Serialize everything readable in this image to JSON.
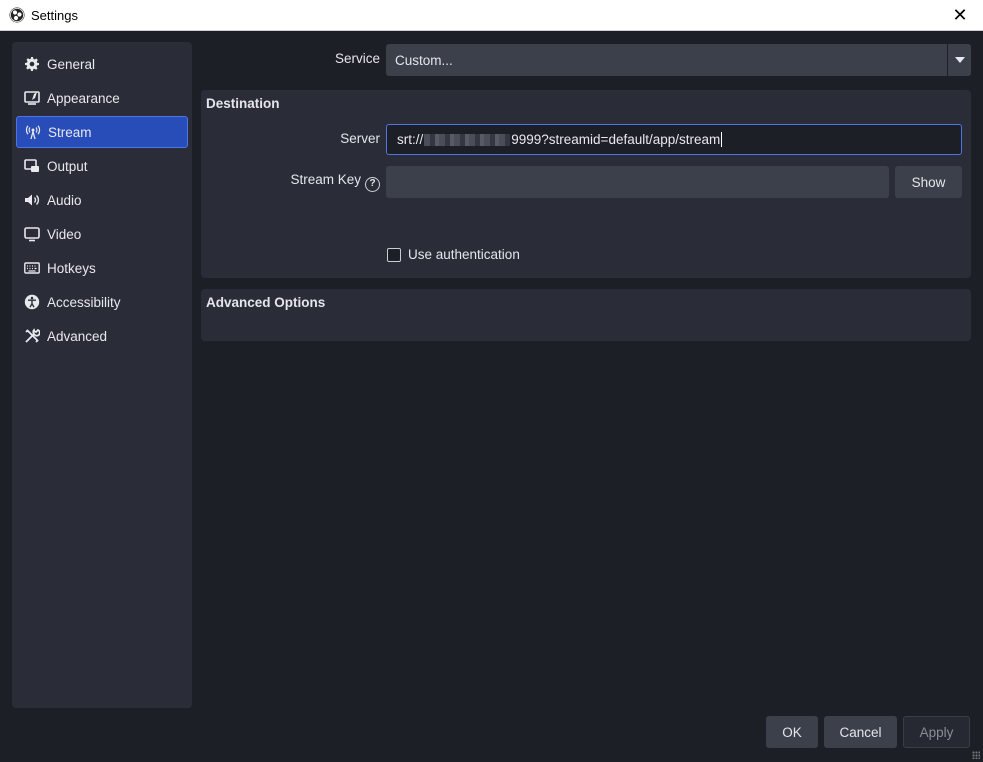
{
  "window": {
    "title": "Settings",
    "close_glyph": "✕"
  },
  "sidebar": {
    "items": [
      {
        "label": "General",
        "icon": "gear-icon"
      },
      {
        "label": "Appearance",
        "icon": "appearance-icon"
      },
      {
        "label": "Stream",
        "icon": "antenna-icon",
        "active": true
      },
      {
        "label": "Output",
        "icon": "output-icon"
      },
      {
        "label": "Audio",
        "icon": "speaker-icon"
      },
      {
        "label": "Video",
        "icon": "monitor-icon"
      },
      {
        "label": "Hotkeys",
        "icon": "keyboard-icon"
      },
      {
        "label": "Accessibility",
        "icon": "accessibility-icon"
      },
      {
        "label": "Advanced",
        "icon": "tools-icon"
      }
    ]
  },
  "service": {
    "label": "Service",
    "value": "Custom..."
  },
  "destination": {
    "title": "Destination",
    "server_label": "Server",
    "server_prefix": "srt://",
    "server_suffix": "9999?streamid=default/app/stream",
    "stream_key_label": "Stream Key",
    "stream_key_value": "",
    "show_label": "Show",
    "use_auth_label": "Use authentication",
    "use_auth_checked": false
  },
  "advanced": {
    "title": "Advanced Options"
  },
  "footer": {
    "ok": "OK",
    "cancel": "Cancel",
    "apply": "Apply"
  },
  "colors": {
    "accent": "#284cb8",
    "accent_border": "#4e74e6",
    "panel": "#2a2d37",
    "background": "#1d1f26",
    "control": "#3c404b"
  }
}
